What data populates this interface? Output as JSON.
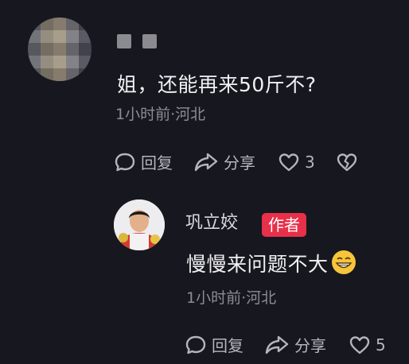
{
  "comment": {
    "text": "姐，还能再来50斤不?",
    "meta": "1小时前·河北",
    "reply_label": "回复",
    "share_label": "分享",
    "like_count": "3"
  },
  "reply": {
    "username": "巩立姣",
    "badge": "作者",
    "text": "慢慢来问题不大",
    "meta": "1小时前·河北",
    "reply_label": "回复",
    "share_label": "分享",
    "like_count": "5"
  },
  "colors": {
    "background": "#17171f",
    "badge": "#e8304a",
    "meta": "#8c8c95"
  }
}
